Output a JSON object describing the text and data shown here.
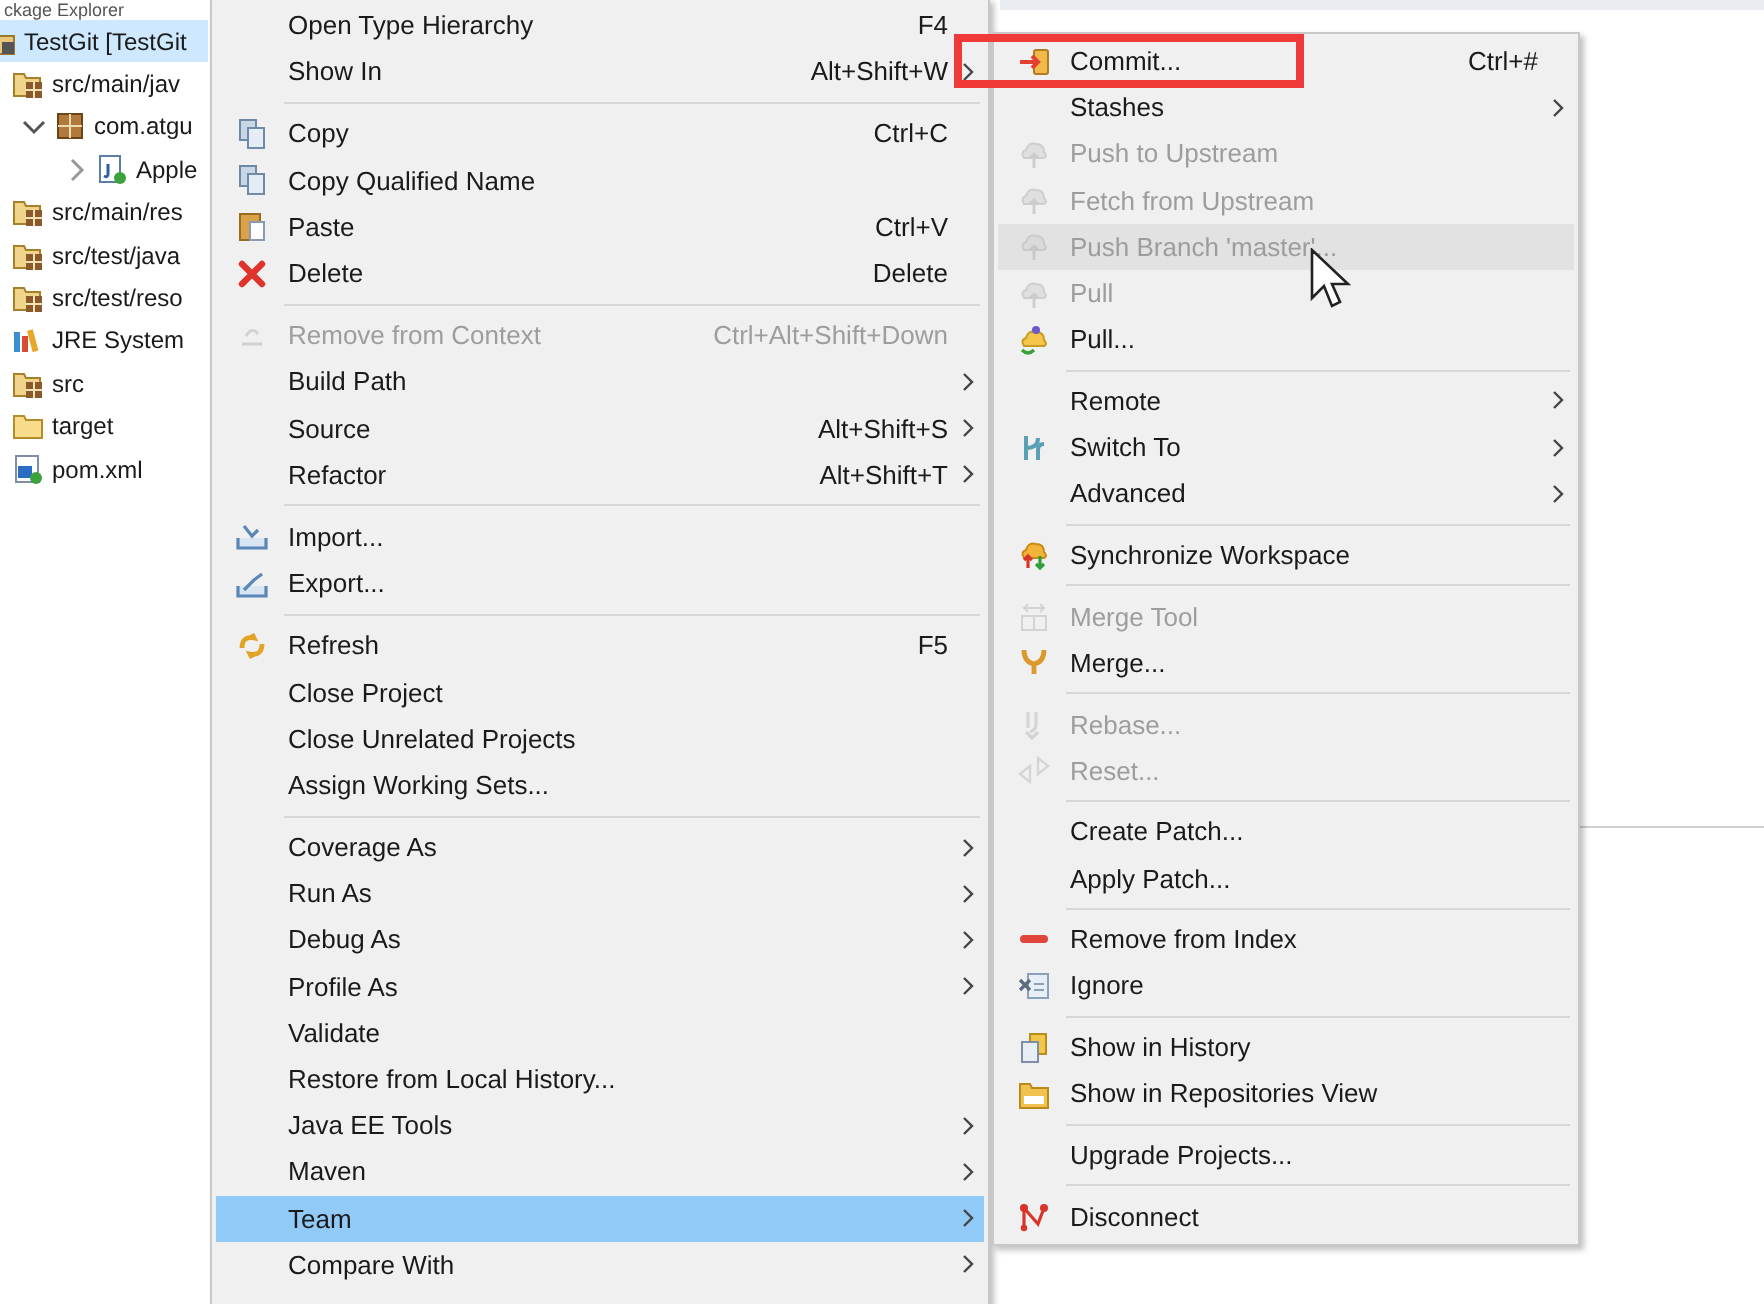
{
  "explorer": {
    "title": "ckage Explorer",
    "tree": [
      {
        "label": "TestGit [TestGit",
        "kind": "project",
        "selected": true,
        "children": [
          {
            "label": "src/main/jav",
            "kind": "source-folder",
            "selected": false,
            "children": [
              {
                "label": "com.atgu",
                "kind": "package",
                "selected": false,
                "expanded": true,
                "children": [
                  {
                    "label": "Apple",
                    "kind": "java-file",
                    "selected": false,
                    "expanded": false
                  }
                ]
              }
            ]
          },
          {
            "label": "src/main/res",
            "kind": "source-folder",
            "selected": false
          },
          {
            "label": "src/test/java",
            "kind": "source-folder",
            "selected": false
          },
          {
            "label": "src/test/reso",
            "kind": "source-folder",
            "selected": false
          },
          {
            "label": "JRE System",
            "kind": "library",
            "selected": false
          },
          {
            "label": "src",
            "kind": "source-folder",
            "selected": false
          },
          {
            "label": "target",
            "kind": "folder",
            "selected": false
          },
          {
            "label": "pom.xml",
            "kind": "xml-file",
            "selected": false
          }
        ]
      }
    ]
  },
  "context_menu": {
    "groups": [
      {
        "items": [
          {
            "label": "Open Type Hierarchy",
            "shortcut": "F4",
            "submenu": false,
            "disabled": false,
            "selected": false
          },
          {
            "label": "Show In",
            "shortcut": "Alt+Shift+W",
            "submenu": true,
            "disabled": false,
            "selected": false
          }
        ]
      },
      {
        "items": [
          {
            "label": "Copy",
            "shortcut": "Ctrl+C",
            "submenu": false,
            "disabled": false,
            "selected": false
          },
          {
            "label": "Copy Qualified Name",
            "submenu": false,
            "disabled": false,
            "selected": false
          },
          {
            "label": "Paste",
            "shortcut": "Ctrl+V",
            "submenu": false,
            "disabled": false,
            "selected": false
          },
          {
            "label": "Delete",
            "shortcut": "Delete",
            "submenu": false,
            "disabled": false,
            "selected": false
          }
        ]
      },
      {
        "items": [
          {
            "label": "Remove from Context",
            "shortcut": "Ctrl+Alt+Shift+Down",
            "submenu": false,
            "disabled": true,
            "selected": false
          },
          {
            "label": "Build Path",
            "submenu": true,
            "disabled": false,
            "selected": false
          },
          {
            "label": "Source",
            "shortcut": "Alt+Shift+S",
            "submenu": true,
            "disabled": false,
            "selected": false
          },
          {
            "label": "Refactor",
            "shortcut": "Alt+Shift+T",
            "submenu": true,
            "disabled": false,
            "selected": false
          }
        ]
      },
      {
        "items": [
          {
            "label": "Import...",
            "submenu": false,
            "disabled": false,
            "selected": false
          },
          {
            "label": "Export...",
            "submenu": false,
            "disabled": false,
            "selected": false
          }
        ]
      },
      {
        "items": [
          {
            "label": "Refresh",
            "shortcut": "F5",
            "submenu": false,
            "disabled": false,
            "selected": false
          },
          {
            "label": "Close Project",
            "submenu": false,
            "disabled": false,
            "selected": false
          },
          {
            "label": "Close Unrelated Projects",
            "submenu": false,
            "disabled": false,
            "selected": false
          },
          {
            "label": "Assign Working Sets...",
            "submenu": false,
            "disabled": false,
            "selected": false
          }
        ]
      },
      {
        "items": [
          {
            "label": "Coverage As",
            "submenu": true,
            "disabled": false,
            "selected": false
          },
          {
            "label": "Run As",
            "submenu": true,
            "disabled": false,
            "selected": false
          },
          {
            "label": "Debug As",
            "submenu": true,
            "disabled": false,
            "selected": false
          },
          {
            "label": "Profile As",
            "submenu": true,
            "disabled": false,
            "selected": false
          },
          {
            "label": "Validate",
            "submenu": false,
            "disabled": false,
            "selected": false
          },
          {
            "label": "Restore from Local History...",
            "submenu": false,
            "disabled": false,
            "selected": false
          },
          {
            "label": "Java EE Tools",
            "submenu": true,
            "disabled": false,
            "selected": false
          },
          {
            "label": "Maven",
            "submenu": true,
            "disabled": false,
            "selected": false
          },
          {
            "label": "Team",
            "submenu": true,
            "disabled": false,
            "selected": true
          },
          {
            "label": "Compare With",
            "submenu": true,
            "disabled": false,
            "selected": false
          }
        ]
      }
    ]
  },
  "team_submenu": {
    "groups": [
      {
        "items": [
          {
            "label": "Commit...",
            "shortcut": "Ctrl+#",
            "submenu": false,
            "disabled": false,
            "selected": false
          },
          {
            "label": "Stashes",
            "submenu": true,
            "disabled": false,
            "selected": false
          },
          {
            "label": "Push to Upstream",
            "submenu": false,
            "disabled": true,
            "selected": false
          },
          {
            "label": "Fetch from Upstream",
            "submenu": false,
            "disabled": true,
            "selected": false
          },
          {
            "label": "Push Branch 'master'...",
            "submenu": false,
            "disabled": true,
            "selected": true
          },
          {
            "label": "Pull",
            "submenu": false,
            "disabled": true,
            "selected": false
          },
          {
            "label": "Pull...",
            "submenu": false,
            "disabled": false,
            "selected": false
          }
        ]
      },
      {
        "items": [
          {
            "label": "Remote",
            "submenu": true,
            "disabled": false,
            "selected": false
          },
          {
            "label": "Switch To",
            "submenu": true,
            "disabled": false,
            "selected": false
          },
          {
            "label": "Advanced",
            "submenu": true,
            "disabled": false,
            "selected": false
          }
        ]
      },
      {
        "items": [
          {
            "label": "Synchronize Workspace",
            "submenu": false,
            "disabled": false,
            "selected": false
          }
        ]
      },
      {
        "items": [
          {
            "label": "Merge Tool",
            "submenu": false,
            "disabled": true,
            "selected": false
          },
          {
            "label": "Merge...",
            "submenu": false,
            "disabled": false,
            "selected": false
          }
        ]
      },
      {
        "items": [
          {
            "label": "Rebase...",
            "submenu": false,
            "disabled": true,
            "selected": false
          },
          {
            "label": "Reset...",
            "submenu": false,
            "disabled": true,
            "selected": false
          }
        ]
      },
      {
        "items": [
          {
            "label": "Create Patch...",
            "submenu": false,
            "disabled": false,
            "selected": false
          },
          {
            "label": "Apply Patch...",
            "submenu": false,
            "disabled": false,
            "selected": false
          }
        ]
      },
      {
        "items": [
          {
            "label": "Remove from Index",
            "submenu": false,
            "disabled": false,
            "selected": false
          },
          {
            "label": "Ignore",
            "submenu": false,
            "disabled": false,
            "selected": false
          }
        ]
      },
      {
        "items": [
          {
            "label": "Show in History",
            "submenu": false,
            "disabled": false,
            "selected": false
          },
          {
            "label": "Show in Repositories View",
            "submenu": false,
            "disabled": false,
            "selected": false
          }
        ]
      },
      {
        "items": [
          {
            "label": "Upgrade Projects...",
            "submenu": false,
            "disabled": false,
            "selected": false
          }
        ]
      },
      {
        "items": [
          {
            "label": "Disconnect",
            "submenu": false,
            "disabled": false,
            "selected": false
          }
        ]
      }
    ]
  }
}
